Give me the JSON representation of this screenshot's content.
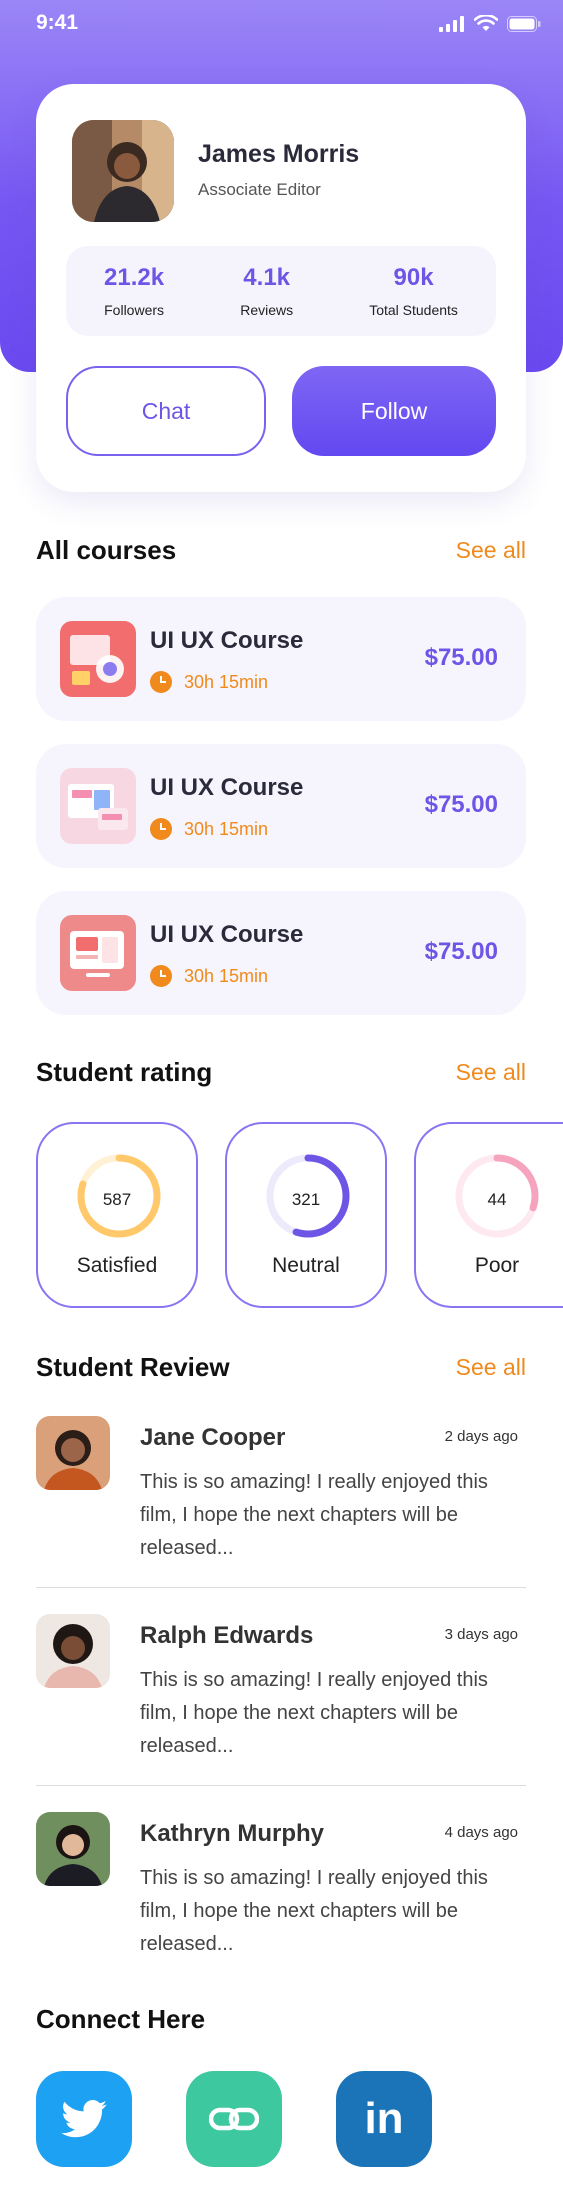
{
  "status_bar": {
    "time": "9:41"
  },
  "profile": {
    "name": "James Morris",
    "role": "Associate Editor",
    "stats": [
      {
        "value": "21.2k",
        "label": "Followers"
      },
      {
        "value": "4.1k",
        "label": "Reviews"
      },
      {
        "value": "90k",
        "label": "Total Students"
      }
    ],
    "chat_label": "Chat",
    "follow_label": "Follow"
  },
  "courses": {
    "title": "All courses",
    "see_all": "See all",
    "items": [
      {
        "title": "UI UX Course",
        "duration": "30h 15min",
        "price": "$75.00"
      },
      {
        "title": "UI UX Course",
        "duration": "30h 15min",
        "price": "$75.00"
      },
      {
        "title": "UI UX Course",
        "duration": "30h 15min",
        "price": "$75.00"
      }
    ]
  },
  "ratings": {
    "title": "Student rating",
    "see_all": "See all",
    "items": [
      {
        "value": "587",
        "label": "Satisfied",
        "progress": 0.8,
        "color": "#ffc96b",
        "track": "#fff1d6"
      },
      {
        "value": "321",
        "label": "Neutral",
        "progress": 0.55,
        "color": "#6e55e6",
        "track": "#eceafb"
      },
      {
        "value": "44",
        "label": "Poor",
        "progress": 0.3,
        "color": "#f6a3bd",
        "track": "#fde9ef"
      }
    ]
  },
  "reviews": {
    "title": "Student Review",
    "see_all": "See all",
    "items": [
      {
        "name": "Jane Cooper",
        "ago": "2 days ago",
        "text": "This is so amazing! I really enjoyed this film, I hope the next chapters will be released..."
      },
      {
        "name": "Ralph Edwards",
        "ago": "3 days ago",
        "text": "This is so amazing! I really enjoyed this film, I hope the next chapters will be released..."
      },
      {
        "name": "Kathryn Murphy",
        "ago": "4 days ago",
        "text": "This is so amazing! I really enjoyed this film, I hope the next chapters will be released..."
      }
    ]
  },
  "connect": {
    "title": "Connect Here",
    "icons": [
      "twitter-icon",
      "link-icon",
      "linkedin-icon"
    ]
  }
}
